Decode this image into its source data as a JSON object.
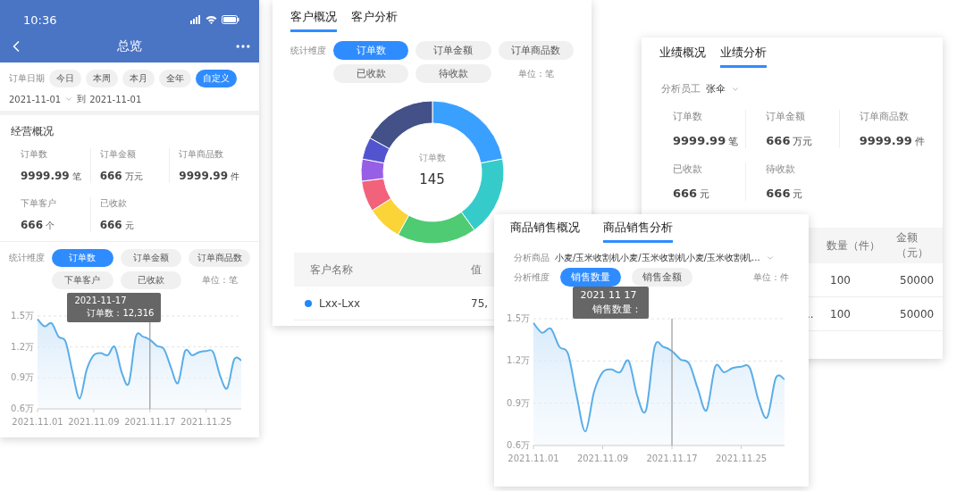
{
  "phone": {
    "status_time": "10:36",
    "title": "总览",
    "date_filter": {
      "label": "订单日期",
      "chips": [
        {
          "label": "今日",
          "selected": false
        },
        {
          "label": "本周",
          "selected": false
        },
        {
          "label": "本月",
          "selected": false
        },
        {
          "label": "全年",
          "selected": false
        },
        {
          "label": "自定义",
          "selected": true
        }
      ]
    },
    "date_range": {
      "start": "2021-11-01",
      "separator": "到",
      "end": "2021-11-01"
    },
    "section_title": "经营概况",
    "stats": [
      {
        "label": "订单数",
        "value": "9999.99",
        "unit": "笔"
      },
      {
        "label": "订单金额",
        "value": "666",
        "unit": "万元"
      },
      {
        "label": "订单商品数",
        "value": "9999.99",
        "unit": "件"
      },
      {
        "label": "下单客户",
        "value": "666",
        "unit": "个"
      },
      {
        "label": "已收款",
        "value": "666",
        "unit": "元"
      }
    ],
    "dimension": {
      "label": "统计维度",
      "chips": [
        {
          "label": "订单数",
          "selected": true
        },
        {
          "label": "订单金额",
          "selected": false
        },
        {
          "label": "订单商品数",
          "selected": false
        },
        {
          "label": "下单客户",
          "selected": false
        },
        {
          "label": "已收款",
          "selected": false
        }
      ],
      "unit": "单位：笔"
    },
    "tooltip": {
      "date": "2021-11-17",
      "text": "订单数：12,316"
    },
    "chart_data": {
      "type": "area",
      "categories": [
        "2021.11.01",
        null,
        null,
        null,
        null,
        null,
        null,
        null,
        "2021.11.09",
        null,
        null,
        null,
        null,
        null,
        null,
        null,
        "2021.11.17",
        null,
        null,
        null,
        null,
        null,
        null,
        null,
        "2021.11.25",
        null,
        null,
        null,
        null,
        null
      ],
      "series": [
        {
          "color": "#5aaee8",
          "values": [
            1.47,
            1.4,
            1.43,
            1.3,
            1.25,
            0.95,
            0.7,
            0.98,
            1.12,
            1.14,
            1.12,
            1.2,
            0.95,
            0.85,
            1.3,
            1.3,
            1.27,
            1.21,
            1.18,
            1.0,
            0.85,
            1.16,
            1.12,
            1.15,
            1.16,
            1.15,
            0.92,
            0.8,
            1.08,
            1.07
          ]
        }
      ],
      "ylim": [
        0.6,
        1.5
      ],
      "yticks": [
        {
          "value": 0.6,
          "label": "0.6万"
        },
        {
          "value": 0.9,
          "label": "0.9万"
        },
        {
          "value": 1.2,
          "label": "1.2万"
        },
        {
          "value": 1.5,
          "label": "1.5万"
        }
      ],
      "annotations": [
        {
          "x": "2021.11.17"
        }
      ]
    }
  },
  "customer_card": {
    "tabs": [
      {
        "label": "客户概况",
        "selected": true
      },
      {
        "label": "客户分析",
        "selected": false
      }
    ],
    "dimension": {
      "label": "统计维度",
      "chips": [
        {
          "label": "订单数",
          "selected": true
        },
        {
          "label": "订单金额",
          "selected": false
        },
        {
          "label": "订单商品数",
          "selected": false
        },
        {
          "label": "已收款",
          "selected": false
        },
        {
          "label": "待收款",
          "selected": false
        }
      ],
      "unit": "单位：笔"
    },
    "donut": {
      "label": "订单数",
      "total": "145"
    },
    "table": {
      "columns": [
        "客户名称",
        "值"
      ],
      "rows": [
        {
          "name": "Lxx-Lxx",
          "value": "75,",
          "color": "#1e88ff"
        }
      ]
    }
  },
  "performance_card": {
    "tabs": [
      {
        "label": "业绩概况",
        "selected": false
      },
      {
        "label": "业绩分析",
        "selected": true
      }
    ],
    "employee": {
      "label": "分析员工",
      "value": "张伞"
    },
    "stats": [
      {
        "label": "订单数",
        "value": "9999.99",
        "unit": "笔"
      },
      {
        "label": "订单金额",
        "value": "666",
        "unit": "万元"
      },
      {
        "label": "订单商品数",
        "value": "9999.99",
        "unit": "件"
      },
      {
        "label": "已收款",
        "value": "666",
        "unit": "元"
      },
      {
        "label": "待收款",
        "value": "666",
        "unit": "元"
      }
    ],
    "table": {
      "columns": [
        "数量（件）",
        "金额（元）"
      ],
      "rows": [
        {
          "lead": "",
          "cells": [
            "100",
            "50000"
          ]
        },
        {
          "lead": "..",
          "cells": [
            "100",
            "50000"
          ]
        }
      ]
    }
  },
  "sales_card": {
    "tabs": [
      {
        "label": "商品销售概况",
        "selected": false
      },
      {
        "label": "商品销售分析",
        "selected": true
      }
    ],
    "product": {
      "label": "分析商品",
      "value": "小麦/玉米收割机小麦/玉米收割机小麦/玉米收割机..."
    },
    "dimension": {
      "label": "分析维度",
      "chips": [
        {
          "label": "销售数量",
          "selected": true
        },
        {
          "label": "销售金额",
          "selected": false
        }
      ],
      "unit": "单位：件"
    },
    "tooltip": {
      "date": "2021 11 17",
      "text": "销售数量："
    },
    "chart_data": {
      "type": "area",
      "categories": [
        "2021.11.01",
        null,
        null,
        null,
        null,
        null,
        null,
        null,
        "2021.11.09",
        null,
        null,
        null,
        null,
        null,
        null,
        null,
        "2021.11.17",
        null,
        null,
        null,
        null,
        null,
        null,
        null,
        "2021.11.25",
        null,
        null,
        null,
        null,
        null
      ],
      "series": [
        {
          "color": "#5aaee8",
          "values": [
            1.47,
            1.4,
            1.43,
            1.3,
            1.25,
            0.95,
            0.7,
            0.98,
            1.12,
            1.14,
            1.12,
            1.2,
            0.95,
            0.85,
            1.3,
            1.3,
            1.27,
            1.21,
            1.18,
            1.0,
            0.85,
            1.16,
            1.12,
            1.15,
            1.16,
            1.15,
            0.92,
            0.8,
            1.08,
            1.07
          ]
        }
      ],
      "ylim": [
        0.6,
        1.5
      ],
      "yticks": [
        {
          "value": 0.6,
          "label": "0.6万"
        },
        {
          "value": 0.9,
          "label": "0.9万"
        },
        {
          "value": 1.2,
          "label": "1.2万"
        },
        {
          "value": 1.5,
          "label": "1.5万"
        }
      ],
      "annotations": [
        {
          "x": "2021.11.17"
        }
      ]
    }
  }
}
